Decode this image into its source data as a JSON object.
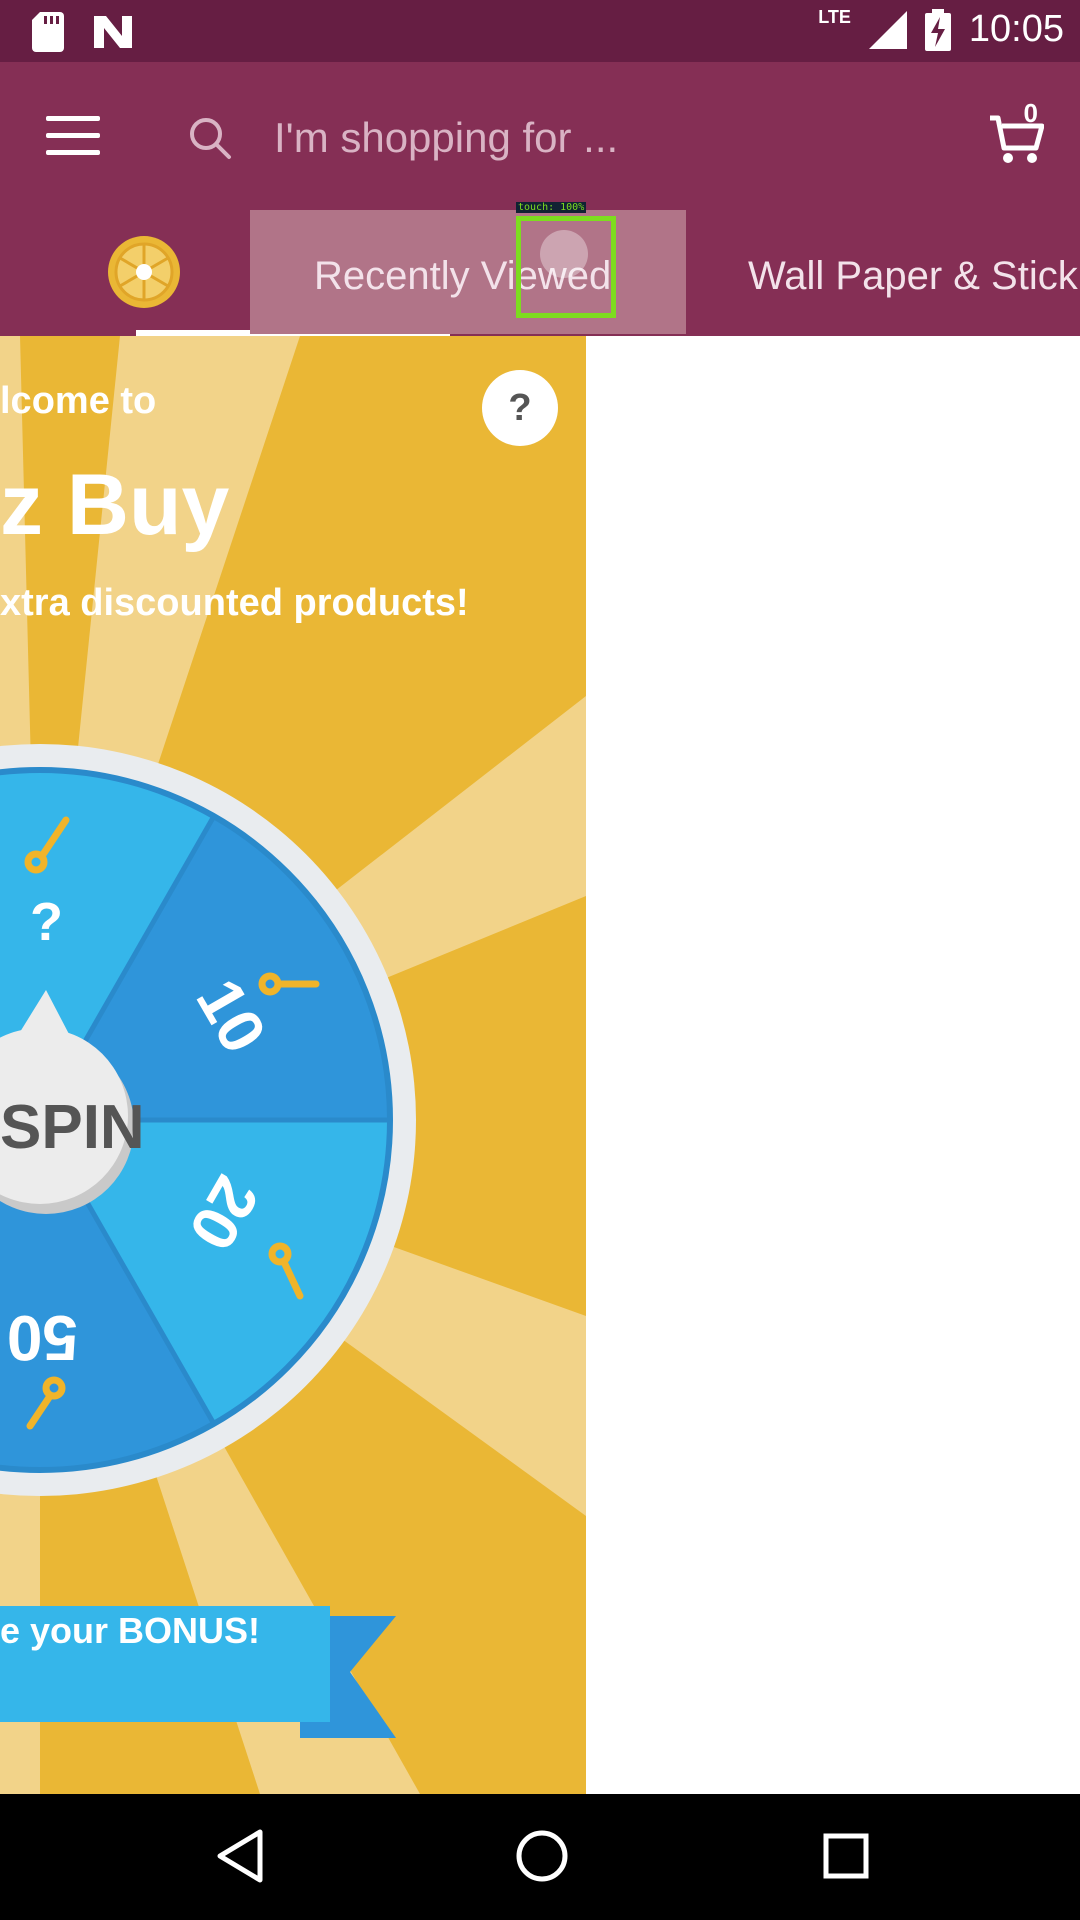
{
  "status_bar": {
    "time": "10:05",
    "network": "LTE"
  },
  "app_bar": {
    "search_placeholder": "I'm shopping for ...",
    "cart_count": "0"
  },
  "tabs": {
    "items": [
      {
        "label": "Recently Viewed"
      },
      {
        "label": "Wall Paper & Stick"
      }
    ],
    "touch_indicator": "touch: 100%"
  },
  "promo": {
    "welcome": "lcome to",
    "brand": "z Buy",
    "tagline": "xtra discounted products!",
    "help": "?",
    "spin": "SPIN",
    "wheel_values": [
      "?",
      "10",
      "20",
      "50"
    ],
    "bonus": "e your BONUS!"
  },
  "colors": {
    "status_bar": "#661e43",
    "app_bar": "#852f55",
    "promo_bg": "#eab735",
    "wheel_blue": "#2f95da",
    "wheel_light_blue": "#35b6ea",
    "touch_box": "#7ddc1f"
  }
}
